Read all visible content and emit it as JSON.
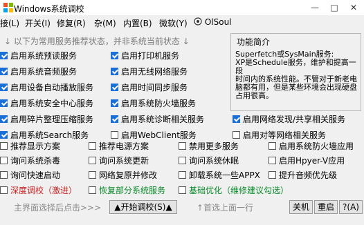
{
  "window": {
    "title": "Windows系统调校",
    "min": "—",
    "max": "□",
    "close": "✕"
  },
  "menu": [
    "接(L)",
    "开关(I)",
    "修复(R)",
    "杂(M)",
    "内置(B)",
    "微软(Y)"
  ],
  "menu_user": "OlSoul",
  "section_label": "以下为常用服务推荐状态，并非系统当前状态",
  "col1": [
    {
      "label": "启用系统预读服务",
      "checked": true
    },
    {
      "label": "启用系统音频服务",
      "checked": true
    },
    {
      "label": "启用设备自动播放服务",
      "checked": true
    },
    {
      "label": "启用系统安全中心服务",
      "checked": true
    },
    {
      "label": "启用碎片整理压缩服务",
      "checked": true
    },
    {
      "label": "启用系统Search服务",
      "checked": true
    }
  ],
  "col2": [
    {
      "label": "启用打印机服务",
      "checked": true
    },
    {
      "label": "启用无线网络服务",
      "checked": true
    },
    {
      "label": "启用时间同步服务",
      "checked": true
    },
    {
      "label": "启用系统防火墙服务",
      "checked": true
    },
    {
      "label": "启用系统诊断相关服务",
      "checked": true
    },
    {
      "label": "启用WebClient服务",
      "checked": false
    }
  ],
  "col3_rows": [
    {
      "label": "启用网络发现/共享相关服务",
      "checked": true
    },
    {
      "label": "启用对等网络相关服务",
      "checked": false
    }
  ],
  "panel": {
    "title": "功能简介",
    "text": "Superfetch或SysMain服务:\nXP是Schedule服务，维护和提高一段\n时间内的系统性能。不管对于新老电\n脑都有用，但是某些环境会出现硬盘\n占用很高。"
  },
  "grid": [
    [
      "推荐显示方案",
      "推荐电源方案",
      "禁用更多服务",
      "启用系统防火墙应用"
    ],
    [
      "询问系统杀毒",
      "询问系统更新",
      "询问系统休眠",
      "启用Hpyer-V应用"
    ],
    [
      "询问快速启动",
      "网络复原并修改",
      "卸载系统一些APPX",
      "提升音频优先级"
    ]
  ],
  "extras": {
    "deep": "深度调校（激进）",
    "restore": "恢复部分系统服务",
    "basic": "基础优化（维修建议勾选）"
  },
  "footer": {
    "left_hint": "主界面选择后点击>>>",
    "start": "▲开始调校(S)▲",
    "sort": "↑首选上面一行",
    "shutdown": "关机",
    "reboot": "重启",
    "help": "?(A)"
  },
  "colors": {
    "accent_blue": "#1a6fd6",
    "red_text": "#cc2222",
    "green_text": "#0a8a2a"
  }
}
